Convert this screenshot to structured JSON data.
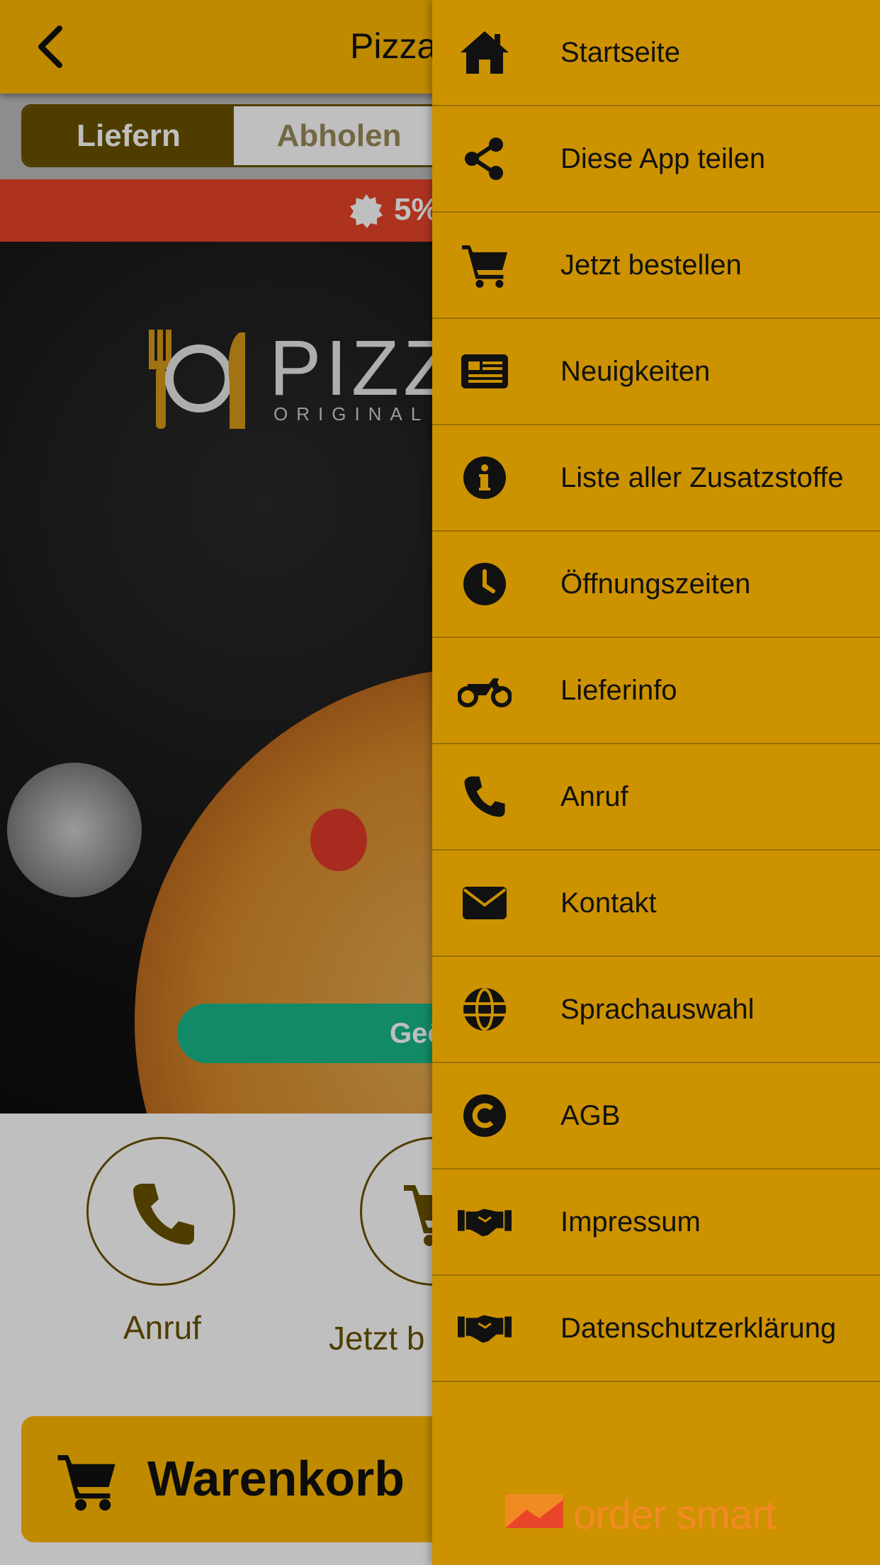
{
  "header": {
    "title": "Pizza"
  },
  "order_mode": {
    "options": [
      "Liefern",
      "Abholen"
    ],
    "selected": "Liefern"
  },
  "promo": {
    "text": "5%"
  },
  "hero": {
    "logo_text": "PIZZA",
    "logo_sub": "ORIGINAL M",
    "geo_button": "Geö"
  },
  "actions": [
    {
      "label": "Anruf",
      "icon": "phone-icon"
    },
    {
      "label": "Jetzt b",
      "icon": "cart-icon"
    }
  ],
  "cart": {
    "label": "Warenkorb"
  },
  "drawer": {
    "items": [
      {
        "label": "Startseite",
        "icon": "home-icon"
      },
      {
        "label": "Diese App teilen",
        "icon": "share-icon"
      },
      {
        "label": "Jetzt bestellen",
        "icon": "cart-icon"
      },
      {
        "label": "Neuigkeiten",
        "icon": "newspaper-icon"
      },
      {
        "label": "Liste aller Zusatzstoffe",
        "icon": "info-icon"
      },
      {
        "label": "Öffnungszeiten",
        "icon": "clock-icon"
      },
      {
        "label": "Lieferinfo",
        "icon": "motorcycle-icon"
      },
      {
        "label": "Anruf",
        "icon": "phone-icon"
      },
      {
        "label": "Kontakt",
        "icon": "envelope-icon"
      },
      {
        "label": "Sprachauswahl",
        "icon": "globe-icon"
      },
      {
        "label": "AGB",
        "icon": "copyright-icon"
      },
      {
        "label": "Impressum",
        "icon": "handshake-icon"
      },
      {
        "label": "Datenschutzerklärung",
        "icon": "handshake-icon"
      }
    ],
    "brand": "order smart"
  },
  "colors": {
    "header": "#ffb800",
    "drawer": "#cc9200",
    "promo": "#e8452a",
    "brand": "#f28a24"
  }
}
